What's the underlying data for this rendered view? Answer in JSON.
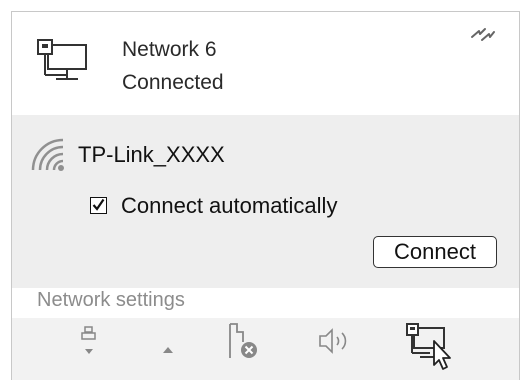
{
  "connection": {
    "name": "Network 6",
    "status": "Connected",
    "icon": "wired-network-icon",
    "airplane_icon": "airplane-mode-icon"
  },
  "wifi": {
    "ssid": "TP-Link_XXXX",
    "icon": "wifi-signal-icon",
    "auto_connect_label": "Connect automatically",
    "auto_connect_checked": true,
    "connect_button": "Connect"
  },
  "settings_link": "Network settings",
  "taskbar": {
    "icons": [
      "usb-device-icon",
      "show-hidden-icons-arrow-icon",
      "power-unplugged-icon",
      "volume-icon",
      "network-tray-icon"
    ]
  }
}
